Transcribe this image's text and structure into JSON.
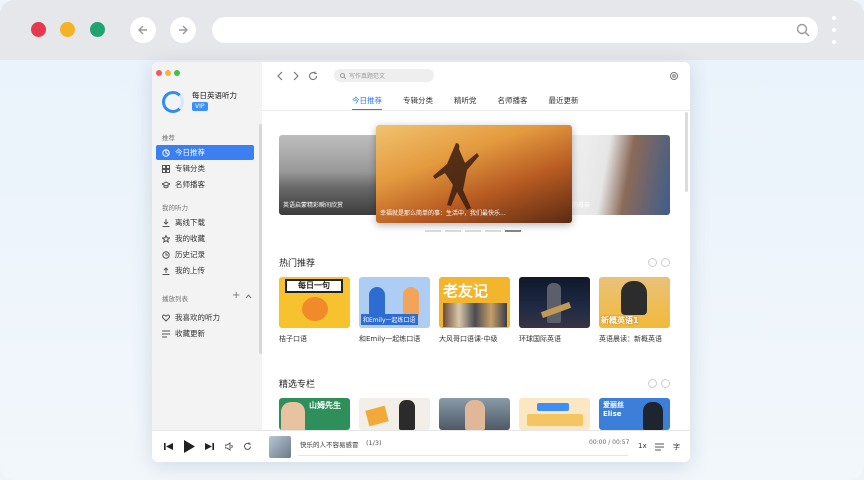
{
  "browser": {
    "url": ""
  },
  "app": {
    "name": "每日英语听力",
    "vip": "VIP",
    "sidebar": {
      "sections": [
        {
          "title": "推荐",
          "items": [
            "今日推荐",
            "专辑分类",
            "名师播客"
          ]
        },
        {
          "title": "我的听力",
          "items": [
            "离线下载",
            "我的收藏",
            "历史记录",
            "我的上传"
          ]
        },
        {
          "title": "播放列表",
          "items": [
            "我喜欢的听力",
            "收藏更新"
          ]
        }
      ]
    },
    "search": {
      "placeholder": "写作真题范文"
    },
    "tabs": [
      "今日推荐",
      "专辑分类",
      "精听党",
      "名师播客",
      "最近更新"
    ],
    "active_tab": "今日推荐",
    "banners": {
      "left": "英语启蒙精彩瞬间欣赏",
      "center": "幸福就是那么简单的事：生活中，我们最快乐...",
      "right": "闲的母亲"
    },
    "hot": {
      "title": "热门推荐",
      "items": [
        {
          "title": "桔子口语",
          "art": "每日一句"
        },
        {
          "title": "和Emily一起练口语",
          "art": "和Emily一起练口语"
        },
        {
          "title": "大风哥口语课-中级",
          "art": "老友记"
        },
        {
          "title": "环球国际英语",
          "art": ""
        },
        {
          "title": "英语晨读：新概英语",
          "art": "新概英语1"
        }
      ]
    },
    "featured": {
      "title": "精选专栏",
      "items": [
        {
          "art": "山姆先生"
        },
        {
          "art": ""
        },
        {
          "art": ""
        },
        {
          "art": ""
        },
        {
          "art": "爱丽丝 Elise"
        }
      ]
    },
    "player": {
      "track": "快乐的人不容易感冒",
      "index": "(1/3)",
      "time": "00:00 / 00:57",
      "speed": "1x",
      "lyrics": "字"
    }
  },
  "colors": {
    "accent": "#3b7ff0",
    "vip": "#3b8ff5"
  }
}
